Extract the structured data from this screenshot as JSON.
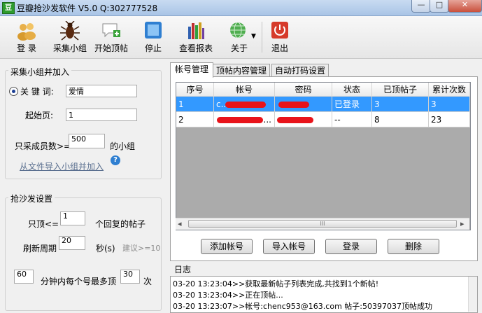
{
  "window": {
    "title": "豆瓣抢沙发软件 V5.0 Q:302777528",
    "app_icon": "豆",
    "minimize_label": "—",
    "maximize_label": "□",
    "close_label": "✕"
  },
  "toolbar": {
    "login": "登 录",
    "collect_groups": "采集小组",
    "start_bump": "开始顶帖",
    "stop": "停止",
    "view_report": "查看报表",
    "about": "关于",
    "exit": "退出",
    "icons": [
      "users-icon",
      "bug-icon",
      "chat-add-icon",
      "stop-square-icon",
      "books-chart-icon",
      "globe-icon",
      "power-icon"
    ]
  },
  "collect_panel": {
    "title": "采集小组并加入",
    "keyword_label": "关 键 词:",
    "keyword_value": "爱情",
    "start_page_label": "起始页:",
    "start_page_value": "1",
    "members_prefix": "只采成员数>=",
    "members_value": "500",
    "members_suffix": "的小组",
    "import_link": "从文件导入小组并加入",
    "help_icon": "?"
  },
  "sofa_panel": {
    "title": "抢沙发设置",
    "only_top_label": "只顶<=",
    "only_top_value": "1",
    "only_top_suffix": "个回复的帖子",
    "refresh_label": "刷新周期",
    "refresh_value": "20",
    "refresh_unit": "秒(s)",
    "refresh_hint": "建议>=10",
    "limit_minutes": "60",
    "limit_middle": "分钟内每个号最多顶",
    "limit_times": "30",
    "limit_unit": "次"
  },
  "tabs": [
    "帐号管理",
    "顶帖内容管理",
    "自动打码设置"
  ],
  "accounts": {
    "columns": [
      "序号",
      "帐号",
      "密码",
      "状态",
      "已顶帖子",
      "累计次数"
    ],
    "rows": [
      {
        "index": "1",
        "account": "c...",
        "password": "",
        "status": "已登录",
        "bumped": "3",
        "total": "3"
      },
      {
        "index": "2",
        "account": "...",
        "password": "",
        "status": "--",
        "bumped": "8",
        "total": "23"
      }
    ],
    "scroll_left": "◂",
    "scroll_right": "▸",
    "scroll_grip": "III"
  },
  "buttons": {
    "add_account": "添加帐号",
    "import_account": "导入帐号",
    "login": "登录",
    "delete": "删除"
  },
  "log": {
    "title": "日志",
    "lines": [
      "03-20 13:23:04>>获取最新帖子列表完成,共找到1个新帖!",
      "03-20 13:23:04>>正在顶帖...",
      "03-20 13:23:07>>帐号:chenc953@163.com  帖子:50397037顶帖成功"
    ]
  },
  "colors": {
    "selection": "#3399ff",
    "redaction": "#e8131a",
    "link": "#5a6f8f"
  }
}
